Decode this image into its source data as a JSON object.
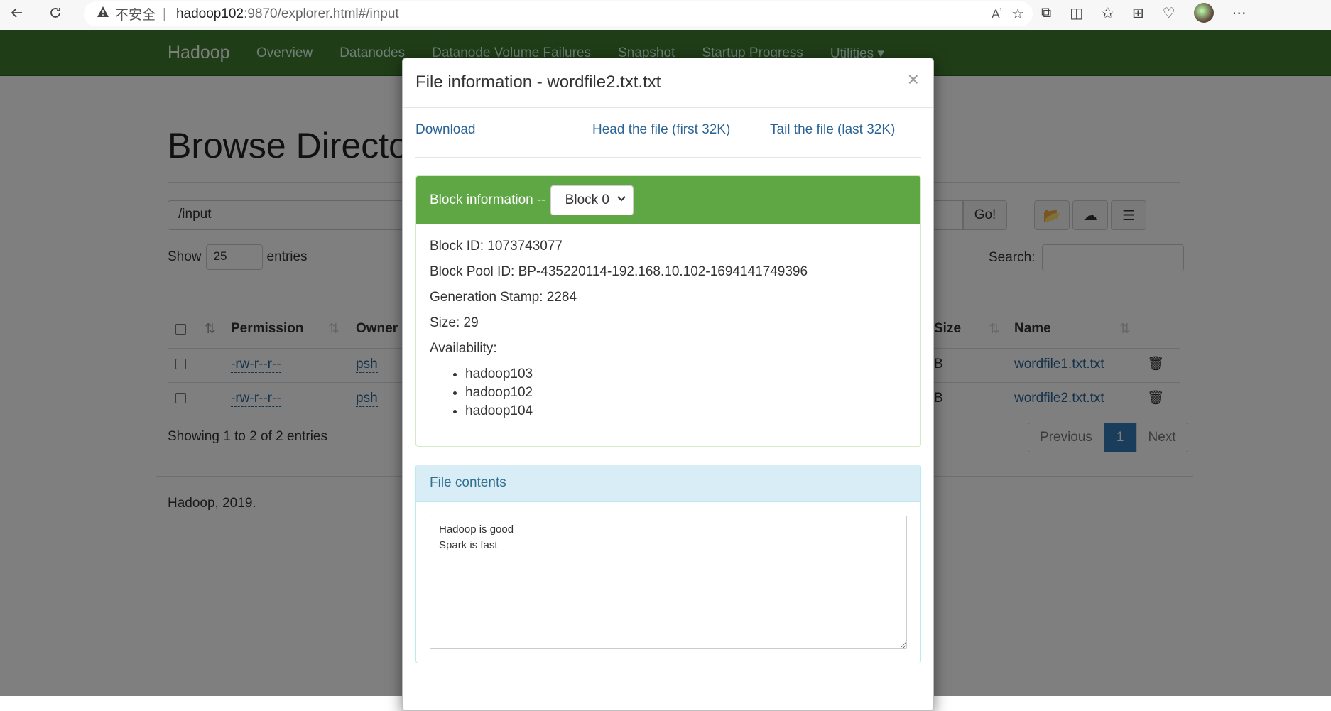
{
  "browser": {
    "insecure_label": "不安全",
    "separator": "|",
    "url_host": "hadoop102",
    "url_rest": ":9870/explorer.html#/input"
  },
  "navbar": {
    "brand": "Hadoop",
    "items": [
      "Overview",
      "Datanodes",
      "Datanode Volume Failures",
      "Snapshot",
      "Startup Progress",
      "Utilities ▾"
    ]
  },
  "page": {
    "title": "Browse Directory",
    "dir_value": "/input",
    "go_label": "Go!",
    "show_label": "Show",
    "entries_select": "25",
    "entries_label": "entries",
    "search_label": "Search:",
    "columns": {
      "permission": "Permission",
      "owner": "Owner",
      "size": "Size",
      "name": "Name"
    },
    "rows": [
      {
        "permission": "-rw-r--r--",
        "owner": "psh",
        "size_fragment": "B",
        "name": "wordfile1.txt.txt"
      },
      {
        "permission": "-rw-r--r--",
        "owner": "psh",
        "size_fragment": "B",
        "name": "wordfile2.txt.txt"
      }
    ],
    "showing": "Showing 1 to 2 of 2 entries",
    "pager": {
      "previous": "Previous",
      "current": "1",
      "next": "Next"
    },
    "footer": "Hadoop, 2019."
  },
  "modal": {
    "title": "File information - wordfile2.txt.txt",
    "close": "×",
    "download": "Download",
    "head": "Head the file (first 32K)",
    "tail": "Tail the file (last 32K)",
    "block_info_label": "Block information --",
    "block_select": "Block 0",
    "block_id": "Block ID: 1073743077",
    "block_pool_id": "Block Pool ID: BP-435220114-192.168.10.102-1694141749396",
    "generation_stamp": "Generation Stamp: 2284",
    "size": "Size: 29",
    "availability_label": "Availability:",
    "availability": [
      "hadoop103",
      "hadoop102",
      "hadoop104"
    ],
    "file_contents_label": "File contents",
    "file_contents": "Hadoop is good\nSpark is fast"
  }
}
